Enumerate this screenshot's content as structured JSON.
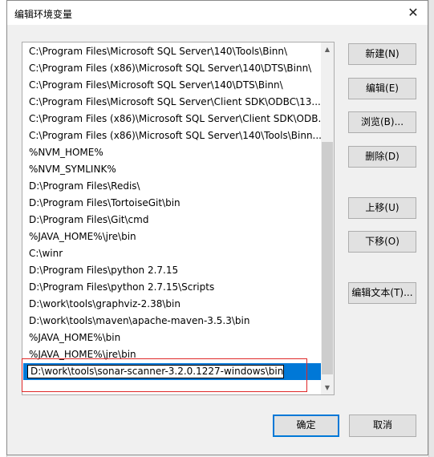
{
  "dialog": {
    "title": "编辑环境变量",
    "close_label": "✕"
  },
  "paths": [
    "C:\\Program Files\\Microsoft SQL Server\\140\\Tools\\Binn\\",
    "C:\\Program Files (x86)\\Microsoft SQL Server\\140\\DTS\\Binn\\",
    "C:\\Program Files\\Microsoft SQL Server\\140\\DTS\\Binn\\",
    "C:\\Program Files\\Microsoft SQL Server\\Client SDK\\ODBC\\13...",
    "C:\\Program Files (x86)\\Microsoft SQL Server\\Client SDK\\ODB...",
    "C:\\Program Files (x86)\\Microsoft SQL Server\\140\\Tools\\Binn...",
    "%NVM_HOME%",
    "%NVM_SYMLINK%",
    "D:\\Program Files\\Redis\\",
    "D:\\Program Files\\TortoiseGit\\bin",
    "D:\\Program Files\\Git\\cmd",
    "%JAVA_HOME%\\jre\\bin",
    "C:\\winr",
    "D:\\Program Files\\python 2.7.15",
    "D:\\Program Files\\python 2.7.15\\Scripts",
    "D:\\work\\tools\\graphviz-2.38\\bin",
    "D:\\work\\tools\\maven\\apache-maven-3.5.3\\bin",
    "%JAVA_HOME%\\bin",
    "%JAVA_HOME%\\jre\\bin"
  ],
  "editing_value": "D:\\work\\tools\\sonar-scanner-3.2.0.1227-windows\\bin",
  "buttons": {
    "new": "新建(N)",
    "edit": "编辑(E)",
    "browse": "浏览(B)...",
    "delete": "删除(D)",
    "move_up": "上移(U)",
    "move_down": "下移(O)",
    "edit_text": "编辑文本(T)...",
    "ok": "确定",
    "cancel": "取消"
  },
  "scrollbar": {
    "up_arrow": "▲",
    "down_arrow": "▼"
  },
  "colors": {
    "selection": "#0078d7",
    "highlight_box": "#e02828",
    "default_button_border": "#0078d7"
  }
}
